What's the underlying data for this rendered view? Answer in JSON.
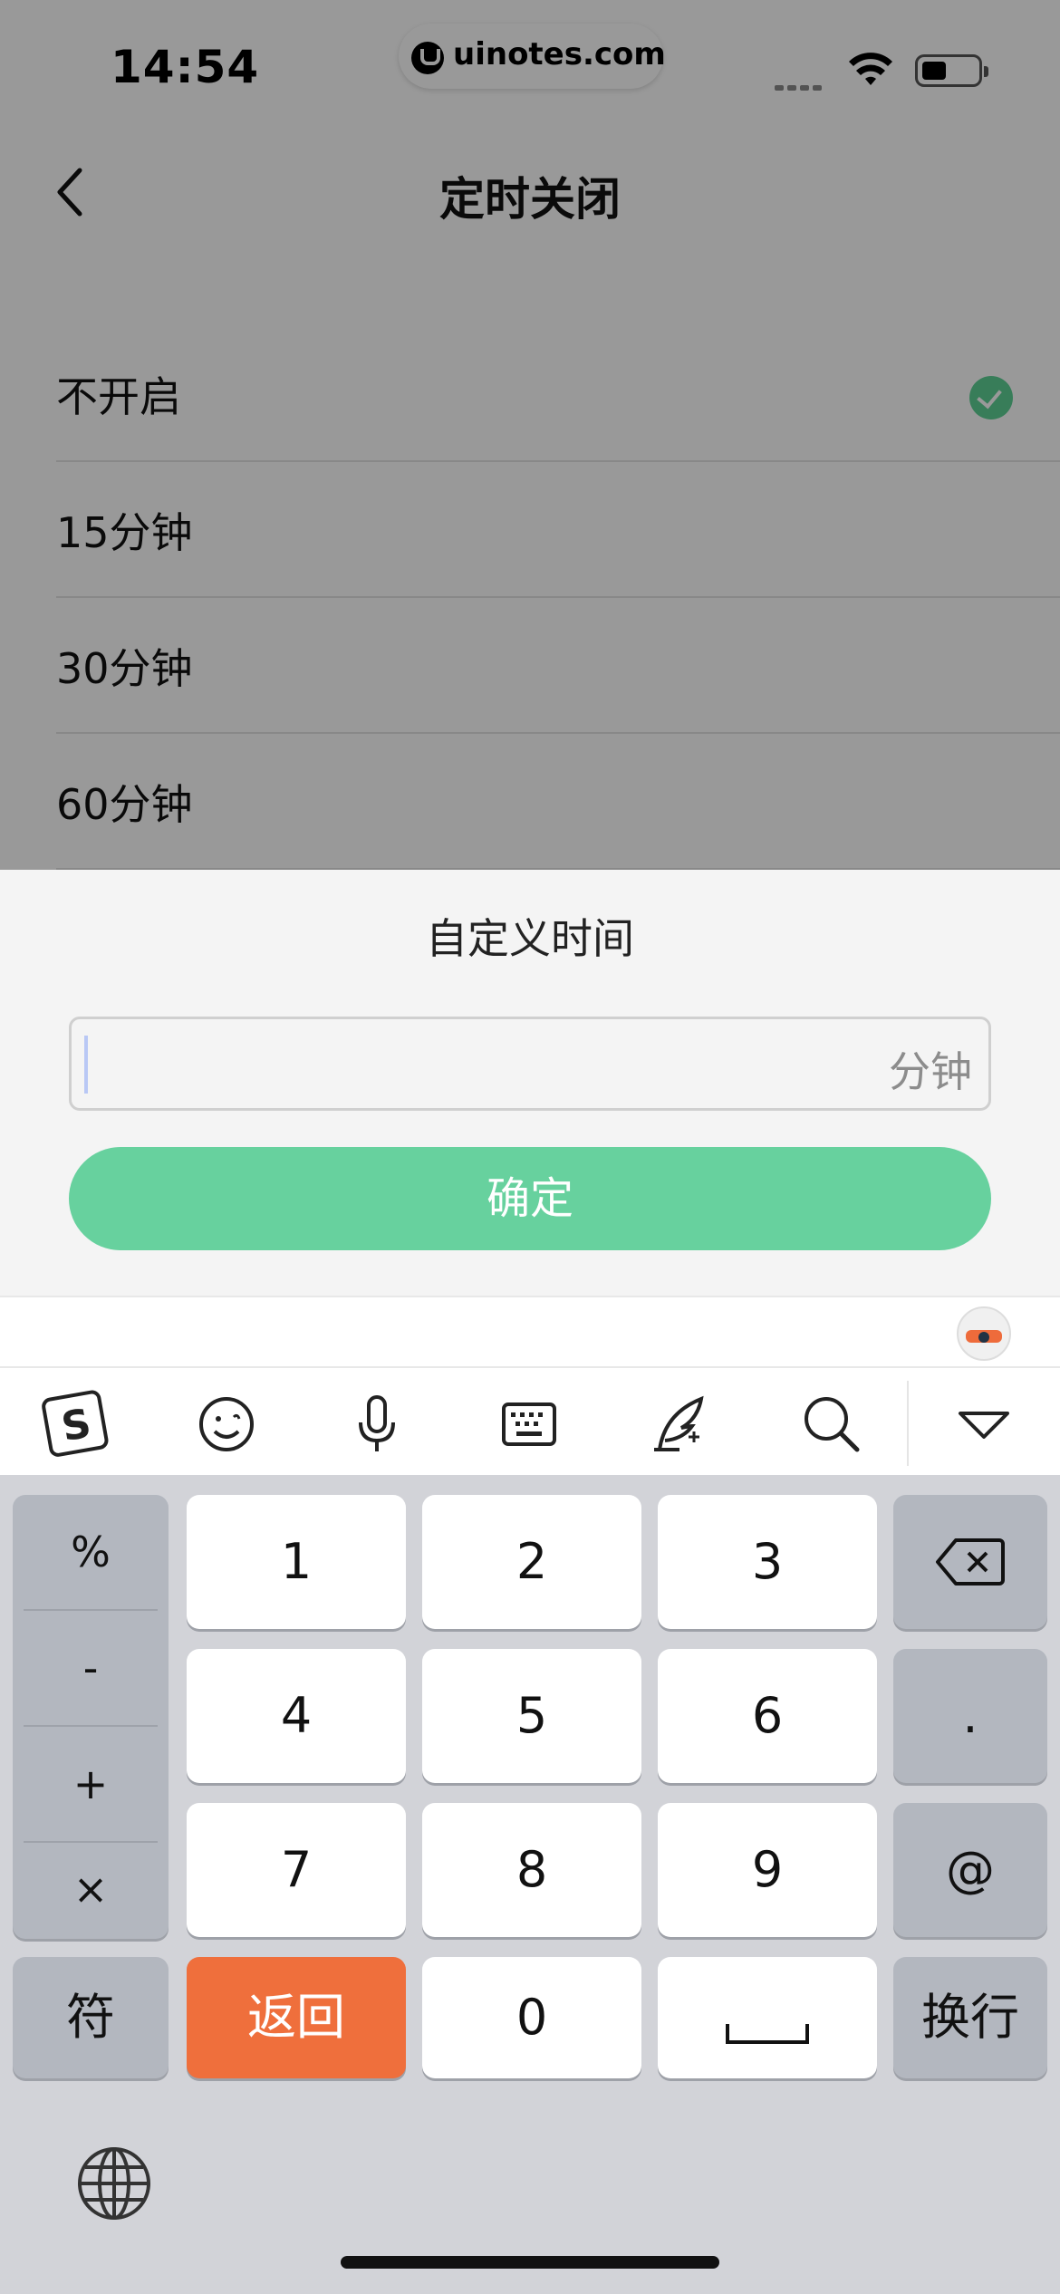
{
  "status_bar": {
    "time": "14:54",
    "url": "uinotes.com"
  },
  "nav": {
    "title": "定时关闭"
  },
  "options": [
    {
      "label": "不开启",
      "selected": true
    },
    {
      "label": "15分钟",
      "selected": false
    },
    {
      "label": "30分钟",
      "selected": false
    },
    {
      "label": "60分钟",
      "selected": false
    }
  ],
  "sheet": {
    "title": "自定义时间",
    "input_value": "",
    "unit": "分钟",
    "confirm_label": "确定"
  },
  "keyboard": {
    "symbols": [
      "%",
      "-",
      "+",
      "×"
    ],
    "digits_row1": [
      "1",
      "2",
      "3"
    ],
    "digits_row2": [
      "4",
      "5",
      "6"
    ],
    "digits_row3": [
      "7",
      "8",
      "9"
    ],
    "dot_label": ".",
    "at_label": "@",
    "fu_label": "符",
    "back_label": "返回",
    "zero_label": "0",
    "enter_label": "换行"
  },
  "colors": {
    "accent_green": "#67d19e",
    "check_green": "#5ed195",
    "keyboard_orange": "#ef6f3c"
  }
}
